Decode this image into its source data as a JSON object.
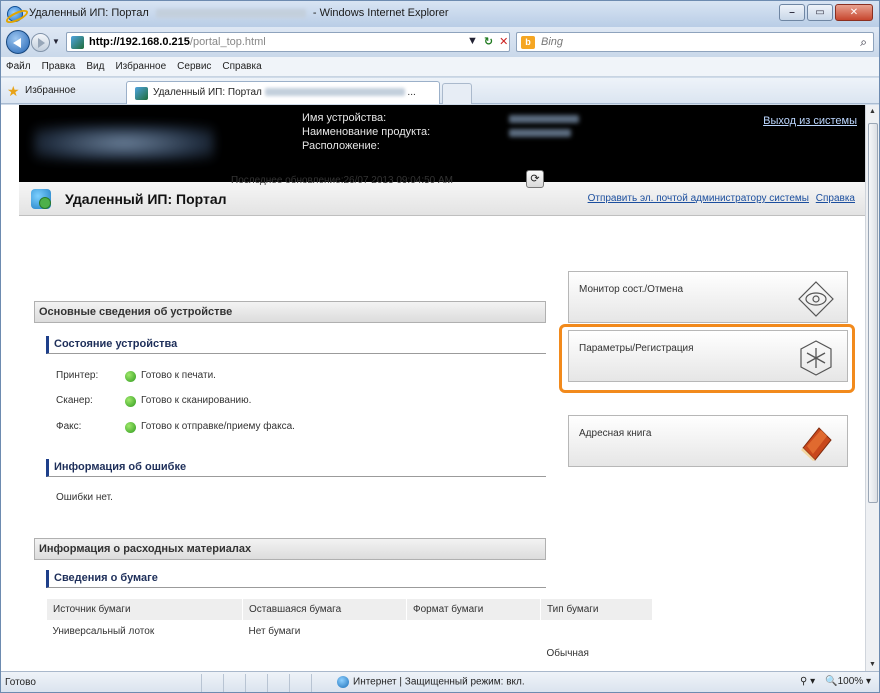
{
  "window": {
    "title_prefix": "Удаленный ИП: Портал",
    "title_suffix": "- Windows Internet Explorer"
  },
  "address": {
    "url_main": "http://192.168.0.215",
    "url_path": "/portal_top.html",
    "search_placeholder": "Bing",
    "bing_letter": "b"
  },
  "menu": [
    "Файл",
    "Правка",
    "Вид",
    "Избранное",
    "Сервис",
    "Справка"
  ],
  "favorites": {
    "label": "Избранное",
    "tab_title": "Удаленный ИП: Портал"
  },
  "device": {
    "name_label": "Имя устройства:",
    "product_label": "Наименование продукта:",
    "location_label": "Расположение:",
    "logout": "Выход из системы"
  },
  "portal": {
    "title": "Удаленный ИП: Портал",
    "email_link": "Отправить эл. почтой администратору системы",
    "help_link": "Справка"
  },
  "content": {
    "last_update": "Последнее обновление:26/07 2013 09:04:50 AM",
    "basic_info": "Основные сведения об устройстве",
    "device_status": "Состояние устройства",
    "status": [
      {
        "label": "Принтер:",
        "text": "Готово к печати."
      },
      {
        "label": "Сканер:",
        "text": "Готово к сканированию."
      },
      {
        "label": "Факс:",
        "text": "Готово к отправке/приему факса."
      }
    ],
    "error_info": "Информация об ошибке",
    "no_errors": "Ошибки нет.",
    "consumables": "Информация о расходных материалах",
    "paper_info": "Сведения о бумаге",
    "paper_headers": [
      "Источник бумаги",
      "Оставшаяся бумага",
      "Формат бумаги",
      "Тип бумаги"
    ],
    "paper_rows": [
      [
        "Универсальный лоток",
        "Нет бумаги",
        "",
        ""
      ],
      [
        "",
        "",
        "",
        "Обычная"
      ]
    ]
  },
  "panel": {
    "monitor": "Монитор сост./Отмена",
    "settings": "Параметры/Регистрация",
    "address_book": "Адресная книга"
  },
  "status": {
    "ready": "Готово",
    "zone": "Интернет | Защищенный режим: вкл.",
    "zoom": "100%"
  },
  "colors": {
    "selection_frame": "#f28a1c",
    "header_bg": "#000000",
    "section_accent": "#1e3f8a"
  }
}
